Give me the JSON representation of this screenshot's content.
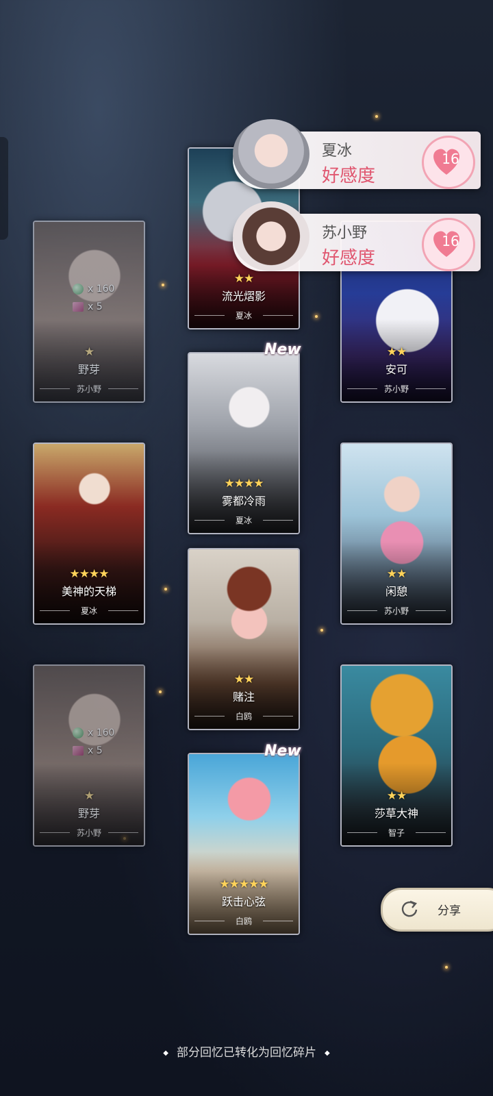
{
  "favorability": [
    {
      "name": "夏冰",
      "label": "好感度",
      "value": "16"
    },
    {
      "name": "苏小野",
      "label": "好感度",
      "value": "16"
    }
  ],
  "cards": {
    "liuguang": {
      "stars": "★★",
      "title": "流光熠影",
      "character": "夏冰"
    },
    "yaya1": {
      "stars": "★",
      "title": "野芽",
      "character": "苏小野",
      "reward_gems": "x 160",
      "reward_items": "x 5"
    },
    "anke": {
      "stars": "★★",
      "title": "安可",
      "character": "苏小野"
    },
    "wudu": {
      "stars": "★★★★",
      "title": "雾都冷雨",
      "character": "夏冰",
      "new": "New"
    },
    "meishen": {
      "stars": "★★★★",
      "title": "美神的天梯",
      "character": "夏冰"
    },
    "xianqi": {
      "stars": "★★",
      "title": "闲憩",
      "character": "苏小野"
    },
    "duzhu": {
      "stars": "★★",
      "title": "赌注",
      "character": "白鸥"
    },
    "yaya2": {
      "stars": "★",
      "title": "野芽",
      "character": "苏小野",
      "reward_gems": "x 160",
      "reward_items": "x 5"
    },
    "shacao": {
      "stars": "★★",
      "title": "莎草大神",
      "character": "智子"
    },
    "yueji": {
      "stars": "★★★★★",
      "title": "跃击心弦",
      "character": "白鸥",
      "new": "New"
    }
  },
  "share": {
    "label": "分享",
    "icon": "share-arrow-icon"
  },
  "footer": {
    "note": "部分回忆已转化为回忆碎片",
    "bullet": "◆"
  }
}
